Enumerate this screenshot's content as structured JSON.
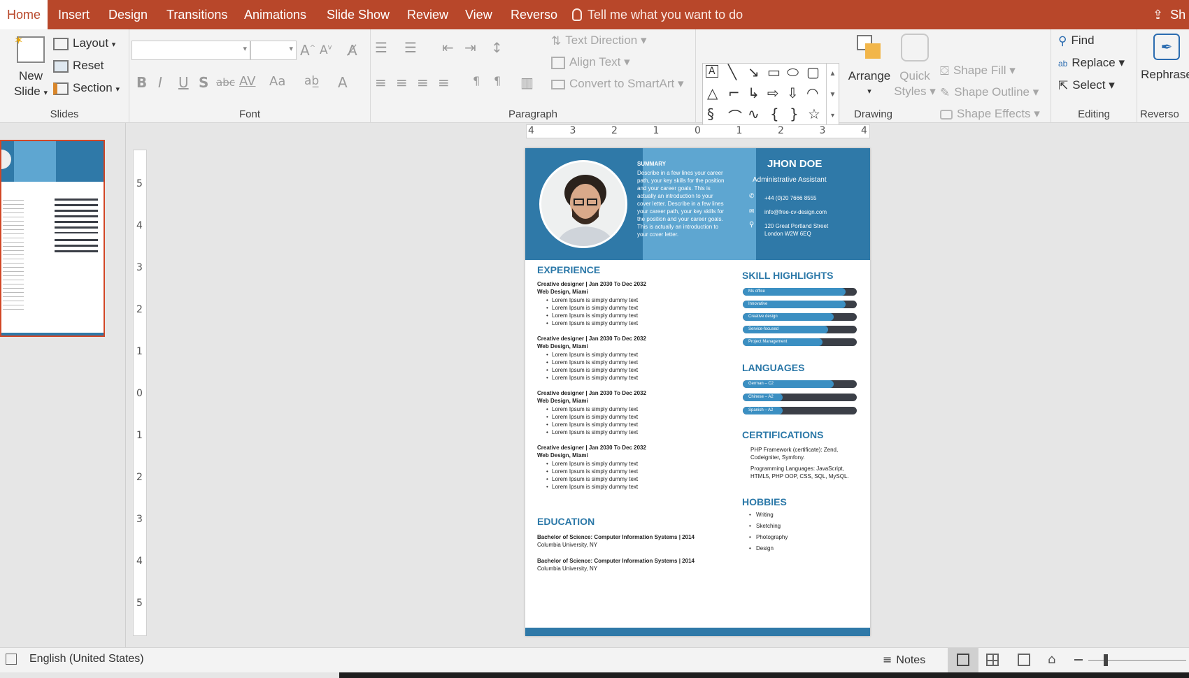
{
  "tabs": [
    "Home",
    "Insert",
    "Design",
    "Transitions",
    "Animations",
    "Slide Show",
    "Review",
    "View",
    "Reverso"
  ],
  "tellme": "Tell me what you want to do",
  "share": "Sh",
  "slides_group": {
    "new_slide_line1": "New",
    "new_slide_line2": "Slide",
    "layout": "Layout",
    "reset": "Reset",
    "section": "Section",
    "label": "Slides"
  },
  "font_group": {
    "label": "Font",
    "bold": "B",
    "italic": "I",
    "underline": "U",
    "shadow": "S",
    "strike": "abc",
    "spacing": "AV",
    "case": "Aa"
  },
  "paragraph_group": {
    "text_direction": "Text Direction",
    "align_text": "Align Text",
    "convert_smartart": "Convert to SmartArt",
    "label": "Paragraph"
  },
  "drawing_group": {
    "arrange": "Arrange",
    "quick_styles_1": "Quick",
    "quick_styles_2": "Styles",
    "shape_fill": "Shape Fill",
    "shape_outline": "Shape Outline",
    "shape_effects": "Shape Effects",
    "label": "Drawing"
  },
  "editing_group": {
    "find": "Find",
    "replace": "Replace",
    "select": "Select",
    "label": "Editing"
  },
  "reverso_group": {
    "rephrase": "Rephrase",
    "label": "Reverso"
  },
  "resume": {
    "name": "JHON DOE",
    "role": "Administrative Assistant",
    "phone": "+44 (0)20 7666 8555",
    "email": "info@free-cv-design.com",
    "address1": "120 Great Portland Street",
    "address2": "London W2W 6EQ",
    "summary_title": "SUMMARY",
    "summary_lines": [
      "Describe in a few lines your career",
      "path, your key skills for the position",
      "and your career goals. This is",
      "actually an introduction to your",
      "cover letter. Describe in a few lines",
      "your career path, your key skills for",
      "the position and your career goals.",
      "This is actually an introduction to",
      "your cover letter."
    ],
    "experience_title": "EXPERIENCE",
    "jobs": [
      {
        "title": "Creative designer | Jan 2030 To Dec 2032",
        "place": "Web Design, Miami",
        "bullets": [
          "Lorem Ipsum is simply dummy text",
          "Lorem Ipsum is simply dummy text",
          "Lorem Ipsum is simply dummy text",
          "Lorem Ipsum is simply dummy text"
        ]
      },
      {
        "title": "Creative designer | Jan 2030 To Dec 2032",
        "place": "Web Design, Miami",
        "bullets": [
          "Lorem Ipsum is simply dummy text",
          "Lorem Ipsum is simply dummy text",
          "Lorem Ipsum is simply dummy text",
          "Lorem Ipsum is simply dummy text"
        ]
      },
      {
        "title": "Creative designer | Jan 2030 To Dec 2032",
        "place": "Web Design, Miami",
        "bullets": [
          "Lorem Ipsum is simply dummy text",
          "Lorem Ipsum is simply dummy text",
          "Lorem Ipsum is simply dummy text",
          "Lorem Ipsum is simply dummy text"
        ]
      },
      {
        "title": "Creative designer | Jan 2030 To Dec 2032",
        "place": "Web Design, Miami",
        "bullets": [
          "Lorem Ipsum is simply dummy text",
          "Lorem Ipsum is simply dummy text",
          "Lorem Ipsum is simply dummy text",
          "Lorem Ipsum is simply dummy text"
        ]
      }
    ],
    "education_title": "EDUCATION",
    "education": [
      {
        "degree": "Bachelor of Science: Computer Information Systems | 2014",
        "school": "Columbia University, NY"
      },
      {
        "degree": "Bachelor of Science: Computer Information Systems | 2014",
        "school": "Columbia University, NY"
      }
    ],
    "skills_title": "SKILL HIGHLIGHTS",
    "skills": [
      {
        "name": "Ms office",
        "level": 0.9
      },
      {
        "name": "Innovative",
        "level": 0.9
      },
      {
        "name": "Creative design",
        "level": 0.8
      },
      {
        "name": "Service-focused",
        "level": 0.75
      },
      {
        "name": "Project Management",
        "level": 0.7
      }
    ],
    "languages_title": "LANGUAGES",
    "languages": [
      {
        "name": "German – C2",
        "level": 0.8
      },
      {
        "name": "Chinese – A2",
        "level": 0.35
      },
      {
        "name": "Spanish – A2",
        "level": 0.35
      }
    ],
    "certifications_title": "CERTIFICATIONS",
    "cert1": "PHP Framework (certificate): Zend, Codeigniter, Symfony.",
    "cert2": "Programming Languages: JavaScript, HTML5, PHP OOP, CSS, SQL, MySQL.",
    "hobbies_title": "HOBBIES",
    "hobbies": [
      "Writing",
      "Sketching",
      "Photography",
      "Design"
    ]
  },
  "ruler_h": [
    "4",
    "3",
    "2",
    "1",
    "0",
    "1",
    "2",
    "3",
    "4"
  ],
  "ruler_v": [
    "5",
    "4",
    "3",
    "2",
    "1",
    "0",
    "1",
    "2",
    "3",
    "4",
    "5"
  ],
  "status": {
    "language": "English (United States)",
    "notes": "Notes"
  },
  "colors": {
    "accent": "#b8472a",
    "resume_blue": "#2f79a8",
    "resume_light": "#5ea6d1"
  }
}
